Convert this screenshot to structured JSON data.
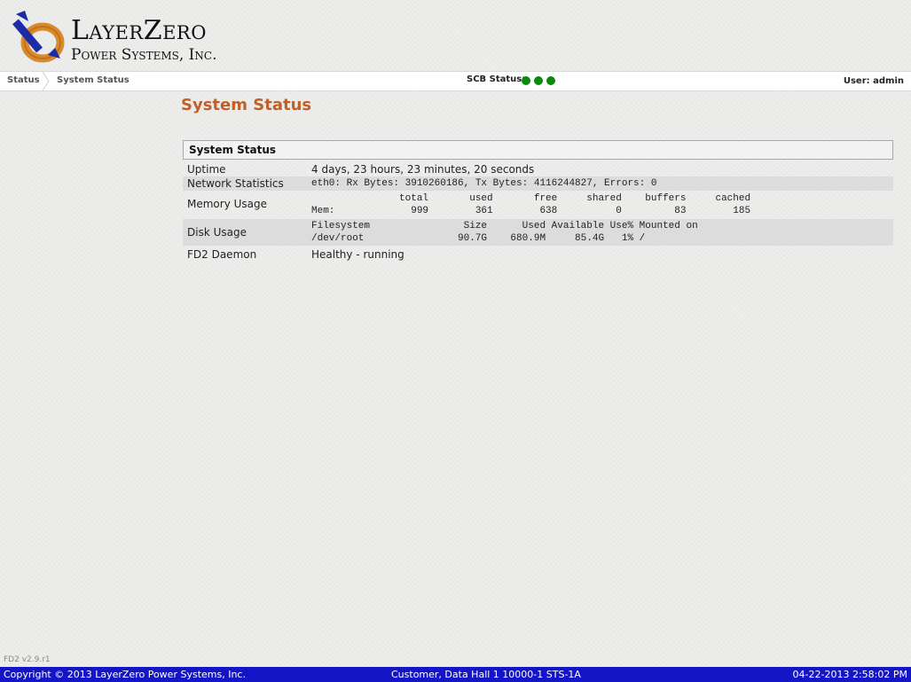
{
  "header": {
    "logo_line1": "LayerZero",
    "logo_line2": "Power Systems, Inc."
  },
  "nav": {
    "breadcrumbs": [
      "Status",
      "System Status"
    ],
    "scb_label": "SCB Status:",
    "scb_indicators": [
      "ok",
      "ok",
      "ok"
    ],
    "user_label": "User: admin"
  },
  "colors": {
    "title": "#c06028",
    "status_ok": "#0a8a0a",
    "footer_bg": "#1515c8"
  },
  "page_title": "System Status",
  "panel": {
    "title": "System Status",
    "rows": [
      {
        "label": "Uptime",
        "value": "4 days, 23 hours, 23 minutes, 20 seconds"
      },
      {
        "label": "Network Statistics",
        "value": "eth0: Rx Bytes: 3910260186, Tx Bytes: 4116244827, Errors: 0"
      },
      {
        "label": "Memory Usage",
        "value": "               total       used       free     shared    buffers     cached\nMem:             999        361        638          0         83        185"
      },
      {
        "label": "Disk Usage",
        "value": "Filesystem                Size      Used Available Use% Mounted on\n/dev/root                90.7G    680.9M     85.4G   1% /"
      },
      {
        "label": "FD2 Daemon",
        "value": "Healthy - running"
      }
    ]
  },
  "version": "FD2 v2.9.r1",
  "footer": {
    "copyright": "Copyright © 2013 LayerZero Power Systems, Inc.",
    "site": "Customer, Data Hall 1   10000-1   STS-1A",
    "timestamp": "04-22-2013 2:58:02 PM"
  }
}
